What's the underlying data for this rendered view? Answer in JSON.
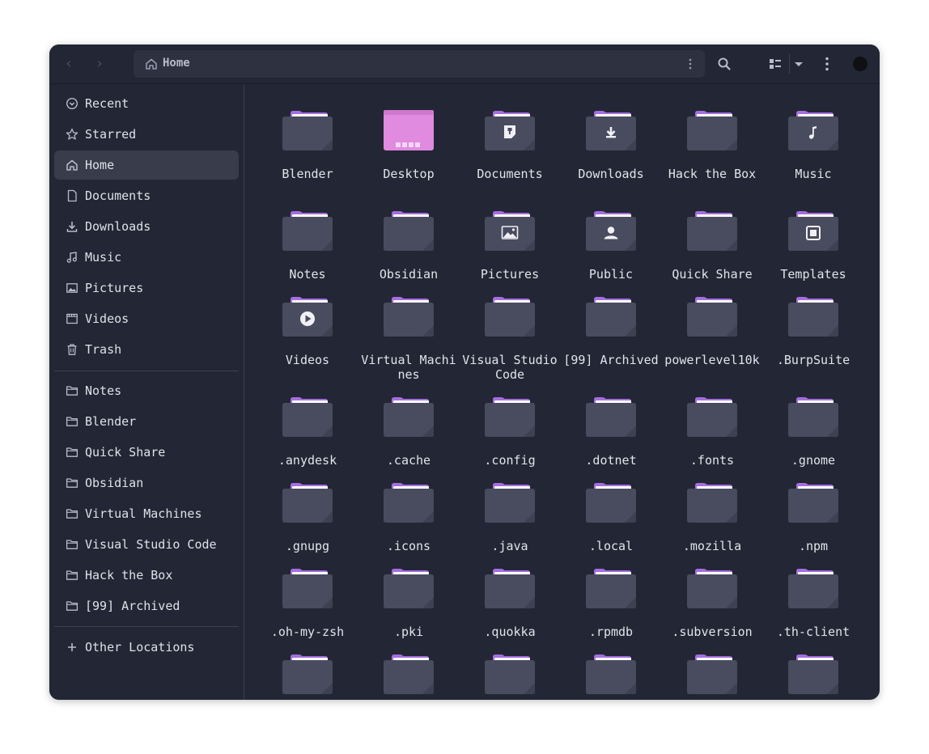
{
  "header": {
    "path_label": "Home",
    "icons": [
      "back-icon",
      "forward-icon",
      "home-icon",
      "path-menu-icon",
      "search-icon",
      "view-list-icon",
      "view-dropdown-icon",
      "main-menu-icon",
      "window-close-icon"
    ]
  },
  "colors": {
    "window_bg": "#232634",
    "sidebar_active": "#393c4b",
    "folder_body": "#494b5e",
    "folder_tab": "#a66ee0",
    "desktop_folder": "#e08ae0",
    "text": "#e2e4ea"
  },
  "sidebar": {
    "places": [
      {
        "label": "Recent",
        "icon": "recent-icon"
      },
      {
        "label": "Starred",
        "icon": "star-icon"
      },
      {
        "label": "Home",
        "icon": "home-icon",
        "active": true
      },
      {
        "label": "Documents",
        "icon": "document-icon"
      },
      {
        "label": "Downloads",
        "icon": "download-icon"
      },
      {
        "label": "Music",
        "icon": "music-icon"
      },
      {
        "label": "Pictures",
        "icon": "picture-icon"
      },
      {
        "label": "Videos",
        "icon": "video-icon"
      },
      {
        "label": "Trash",
        "icon": "trash-icon"
      }
    ],
    "bookmarks": [
      {
        "label": "Notes",
        "icon": "folder-icon"
      },
      {
        "label": "Blender",
        "icon": "folder-icon"
      },
      {
        "label": "Quick Share",
        "icon": "folder-icon"
      },
      {
        "label": "Obsidian",
        "icon": "folder-icon"
      },
      {
        "label": "Virtual Machines",
        "icon": "folder-icon"
      },
      {
        "label": "Visual Studio Code",
        "icon": "folder-icon"
      },
      {
        "label": "Hack the Box",
        "icon": "folder-icon"
      },
      {
        "label": "[99] Archived",
        "icon": "folder-icon"
      }
    ],
    "other_locations": {
      "label": "Other Locations",
      "icon": "plus-icon"
    }
  },
  "files": [
    {
      "name": "Blender",
      "emblem": "none"
    },
    {
      "name": "Desktop",
      "emblem": "desktop"
    },
    {
      "name": "Documents",
      "emblem": "document"
    },
    {
      "name": "Downloads",
      "emblem": "download"
    },
    {
      "name": "Hack the Box",
      "emblem": "none"
    },
    {
      "name": "Music",
      "emblem": "music"
    },
    {
      "name": "Notes",
      "emblem": "none"
    },
    {
      "name": "Obsidian",
      "emblem": "none"
    },
    {
      "name": "Pictures",
      "emblem": "picture"
    },
    {
      "name": "Public",
      "emblem": "user"
    },
    {
      "name": "Quick Share",
      "emblem": "none"
    },
    {
      "name": "Templates",
      "emblem": "template"
    },
    {
      "name": "Videos",
      "emblem": "video"
    },
    {
      "name": "Virtual Machines",
      "emblem": "none"
    },
    {
      "name": "Visual Studio Code",
      "emblem": "none"
    },
    {
      "name": "[99] Archived",
      "emblem": "none"
    },
    {
      "name": "powerlevel10k",
      "emblem": "none"
    },
    {
      "name": ".BurpSuite",
      "emblem": "none"
    },
    {
      "name": ".anydesk",
      "emblem": "none"
    },
    {
      "name": ".cache",
      "emblem": "none"
    },
    {
      "name": ".config",
      "emblem": "none"
    },
    {
      "name": ".dotnet",
      "emblem": "none"
    },
    {
      "name": ".fonts",
      "emblem": "none"
    },
    {
      "name": ".gnome",
      "emblem": "none"
    },
    {
      "name": ".gnupg",
      "emblem": "none"
    },
    {
      "name": ".icons",
      "emblem": "none"
    },
    {
      "name": ".java",
      "emblem": "none"
    },
    {
      "name": ".local",
      "emblem": "none"
    },
    {
      "name": ".mozilla",
      "emblem": "none"
    },
    {
      "name": ".npm",
      "emblem": "none"
    },
    {
      "name": ".oh-my-zsh",
      "emblem": "none"
    },
    {
      "name": ".pki",
      "emblem": "none"
    },
    {
      "name": ".quokka",
      "emblem": "none"
    },
    {
      "name": ".rpmdb",
      "emblem": "none"
    },
    {
      "name": ".subversion",
      "emblem": "none"
    },
    {
      "name": ".th-client",
      "emblem": "none"
    },
    {
      "name": "",
      "emblem": "none"
    },
    {
      "name": "",
      "emblem": "none"
    },
    {
      "name": "",
      "emblem": "none"
    },
    {
      "name": "",
      "emblem": "none"
    },
    {
      "name": "",
      "emblem": "none"
    },
    {
      "name": "",
      "emblem": "none"
    }
  ]
}
